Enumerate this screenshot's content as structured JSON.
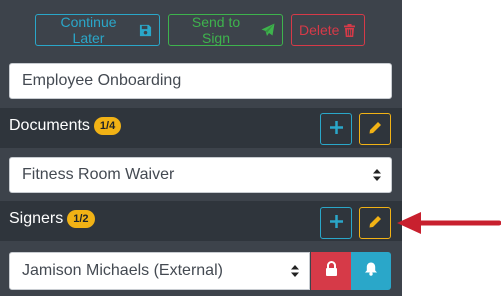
{
  "toolbar": {
    "continue_label": "Continue Later",
    "continue_icon": "save-icon",
    "send_label": "Send to Sign",
    "send_icon": "paper-plane-icon",
    "delete_label": "Delete",
    "delete_icon": "trash-icon"
  },
  "title_field": {
    "value": "Employee Onboarding"
  },
  "documents": {
    "heading": "Documents",
    "badge": "1/4",
    "selected": "Fitness Room Waiver"
  },
  "signers": {
    "heading": "Signers",
    "badge": "1/2",
    "selected": "Jamison Michaels (External)"
  },
  "annotation": {
    "color": "#c8202e",
    "icon": "arrow-left-icon"
  },
  "colors": {
    "panel": "#3d434b",
    "section_bar": "#2f353c",
    "info": "#2aa7c9",
    "success": "#3eb34d",
    "danger": "#d63a48",
    "warning": "#f1b215"
  }
}
